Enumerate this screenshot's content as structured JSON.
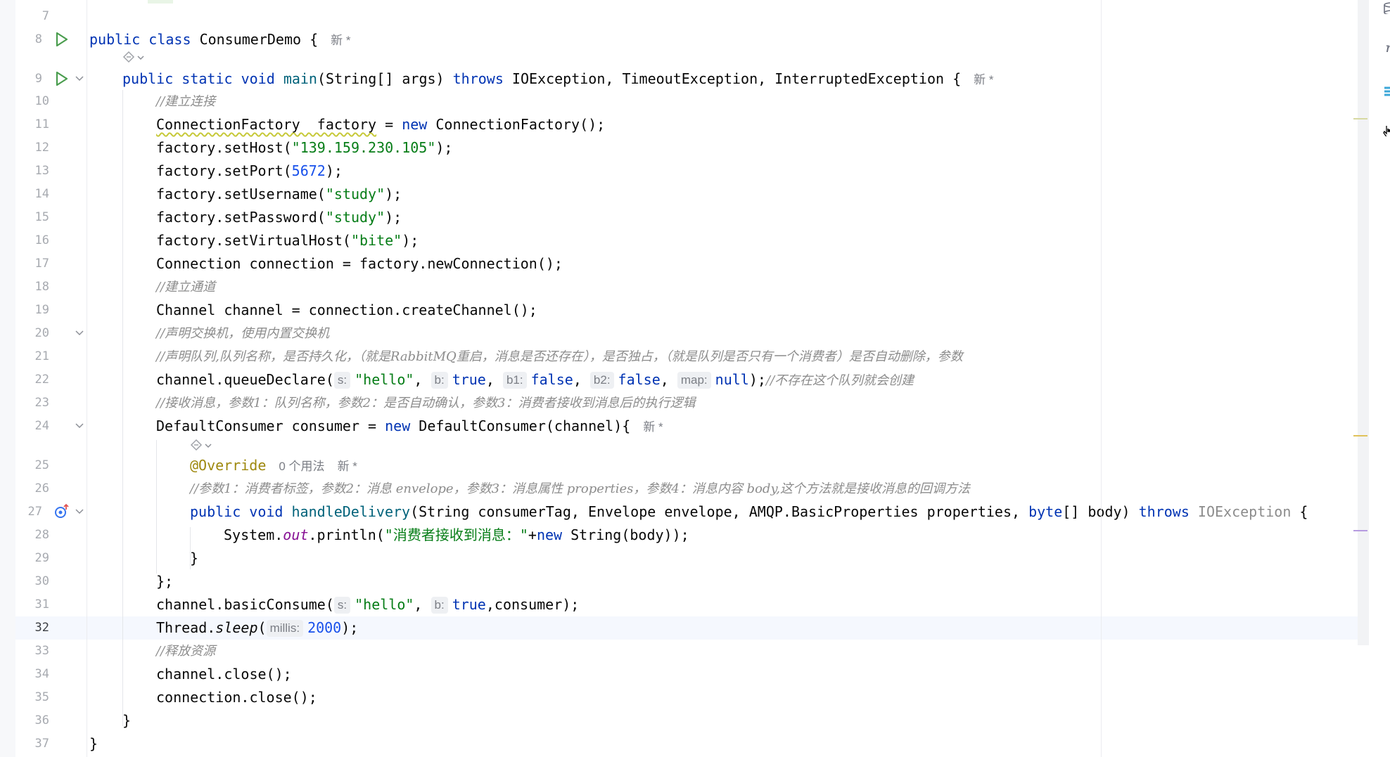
{
  "editor": {
    "lines": [
      {
        "n": "7"
      },
      {
        "n": "8",
        "icon": "run-icon"
      },
      {
        "n": ""
      },
      {
        "n": "9",
        "icon": "run-icon",
        "fold": true
      },
      {
        "n": "10"
      },
      {
        "n": "11"
      },
      {
        "n": "12"
      },
      {
        "n": "13"
      },
      {
        "n": "14"
      },
      {
        "n": "15"
      },
      {
        "n": "16"
      },
      {
        "n": "17"
      },
      {
        "n": "18"
      },
      {
        "n": "19"
      },
      {
        "n": "20",
        "fold": true
      },
      {
        "n": "21"
      },
      {
        "n": "22"
      },
      {
        "n": "23"
      },
      {
        "n": "24",
        "fold": true
      },
      {
        "n": ""
      },
      {
        "n": "25"
      },
      {
        "n": "26"
      },
      {
        "n": "27",
        "icon": "implementation-icon",
        "fold": true
      },
      {
        "n": "28"
      },
      {
        "n": "29"
      },
      {
        "n": "30"
      },
      {
        "n": "31"
      },
      {
        "n": "32",
        "current": true
      },
      {
        "n": "33"
      },
      {
        "n": "34"
      },
      {
        "n": "35"
      },
      {
        "n": "36"
      },
      {
        "n": "37"
      }
    ],
    "code": {
      "l8": {
        "kw_public": "public",
        "kw_class": "class",
        "name": "ConsumerDemo",
        "brace": " {",
        "lens": "新 *"
      },
      "l9": {
        "kw_public": "public",
        "kw_static": "static",
        "kw_void": "void",
        "main": "main",
        "params": "(String[] args) ",
        "kw_throws": "throws",
        "exceptions": " IOException, TimeoutException, InterruptedException {",
        "lens": "新 *"
      },
      "l10": "//建立连接",
      "l11": {
        "type": "ConnectionFactory  factory",
        "eq": " = ",
        "kw_new": "new",
        "rest": " ConnectionFactory();"
      },
      "l12": {
        "pre": "factory.setHost(",
        "str": "\"139.159.230.105\"",
        "post": ");"
      },
      "l13": {
        "pre": "factory.setPort(",
        "num": "5672",
        "post": ");"
      },
      "l14": {
        "pre": "factory.setUsername(",
        "str": "\"study\"",
        "post": ");"
      },
      "l15": {
        "pre": "factory.setPassword(",
        "str": "\"study\"",
        "post": ");"
      },
      "l16": {
        "pre": "factory.setVirtualHost(",
        "str": "\"bite\"",
        "post": ");"
      },
      "l17": "Connection connection = factory.newConnection();",
      "l18": "//建立通道",
      "l19": "Channel channel = connection.createChannel();",
      "l20": "//声明交换机，使用内置交换机",
      "l21": "//声明队列,队列名称，是否持久化，（就是RabbitMQ重启，消息是否还存在），是否独占，（就是队列是否只有一个消费者）是否自动删除，参数",
      "l22": {
        "pre": "channel.queueDeclare(",
        "h1": "s:",
        "str": "\"hello\"",
        "c1": ", ",
        "h2": "b:",
        "v1": "true",
        "c2": ", ",
        "h3": "b1:",
        "v2": "false",
        "c3": ", ",
        "h4": "b2:",
        "v3": "false",
        "c4": ", ",
        "h5": "map:",
        "v4": "null",
        "post": ");",
        "cmt": "//不存在这个队列就会创建"
      },
      "l23": "//接收消息，参数1：队列名称，参数2：是否自动确认，参数3：消费者接收到消息后的执行逻辑",
      "l24": {
        "pre": "DefaultConsumer consumer = ",
        "kw_new": "new",
        "post": " DefaultConsumer(channel){",
        "lens": "新 *"
      },
      "l25": {
        "ann": "@Override",
        "usages": "0 个用法",
        "lens": "新 *"
      },
      "l26": "//参数1：消费者标签，参数2：消息 envelope，参数3：消息属性 properties，参数4：消息内容 body,这个方法就是接收消息的回调方法",
      "l27": {
        "kw_public": "public",
        "kw_void": "void",
        "name": "handleDelivery",
        "params": "(String consumerTag, Envelope envelope, AMQP.BasicProperties properties, ",
        "kw_byte": "byte",
        "params2": "[] body) ",
        "kw_throws": "throws",
        "exc": " IOException",
        "brace": " {"
      },
      "l28": {
        "pre": "System.",
        "fld": "out",
        "mid": ".println(",
        "str": "\"消费者接收到消息：\"",
        "plus": "+",
        "kw_new": "new",
        "post": " String(body));"
      },
      "l29": "}",
      "l30": "};",
      "l31": {
        "pre": "channel.basicConsume(",
        "h1": "s:",
        "str": "\"hello\"",
        "c1": ", ",
        "h2": "b:",
        "v1": "true",
        "post": ",consumer);"
      },
      "l32": {
        "pre": "Thread.",
        "mi": "sleep",
        "open": "(",
        "h1": "millis:",
        "num": "2000",
        "post": ");"
      },
      "l33": "//释放资源",
      "l34": "channel.close();",
      "l35": "connection.close();",
      "l36": "}",
      "l37": "}"
    }
  }
}
